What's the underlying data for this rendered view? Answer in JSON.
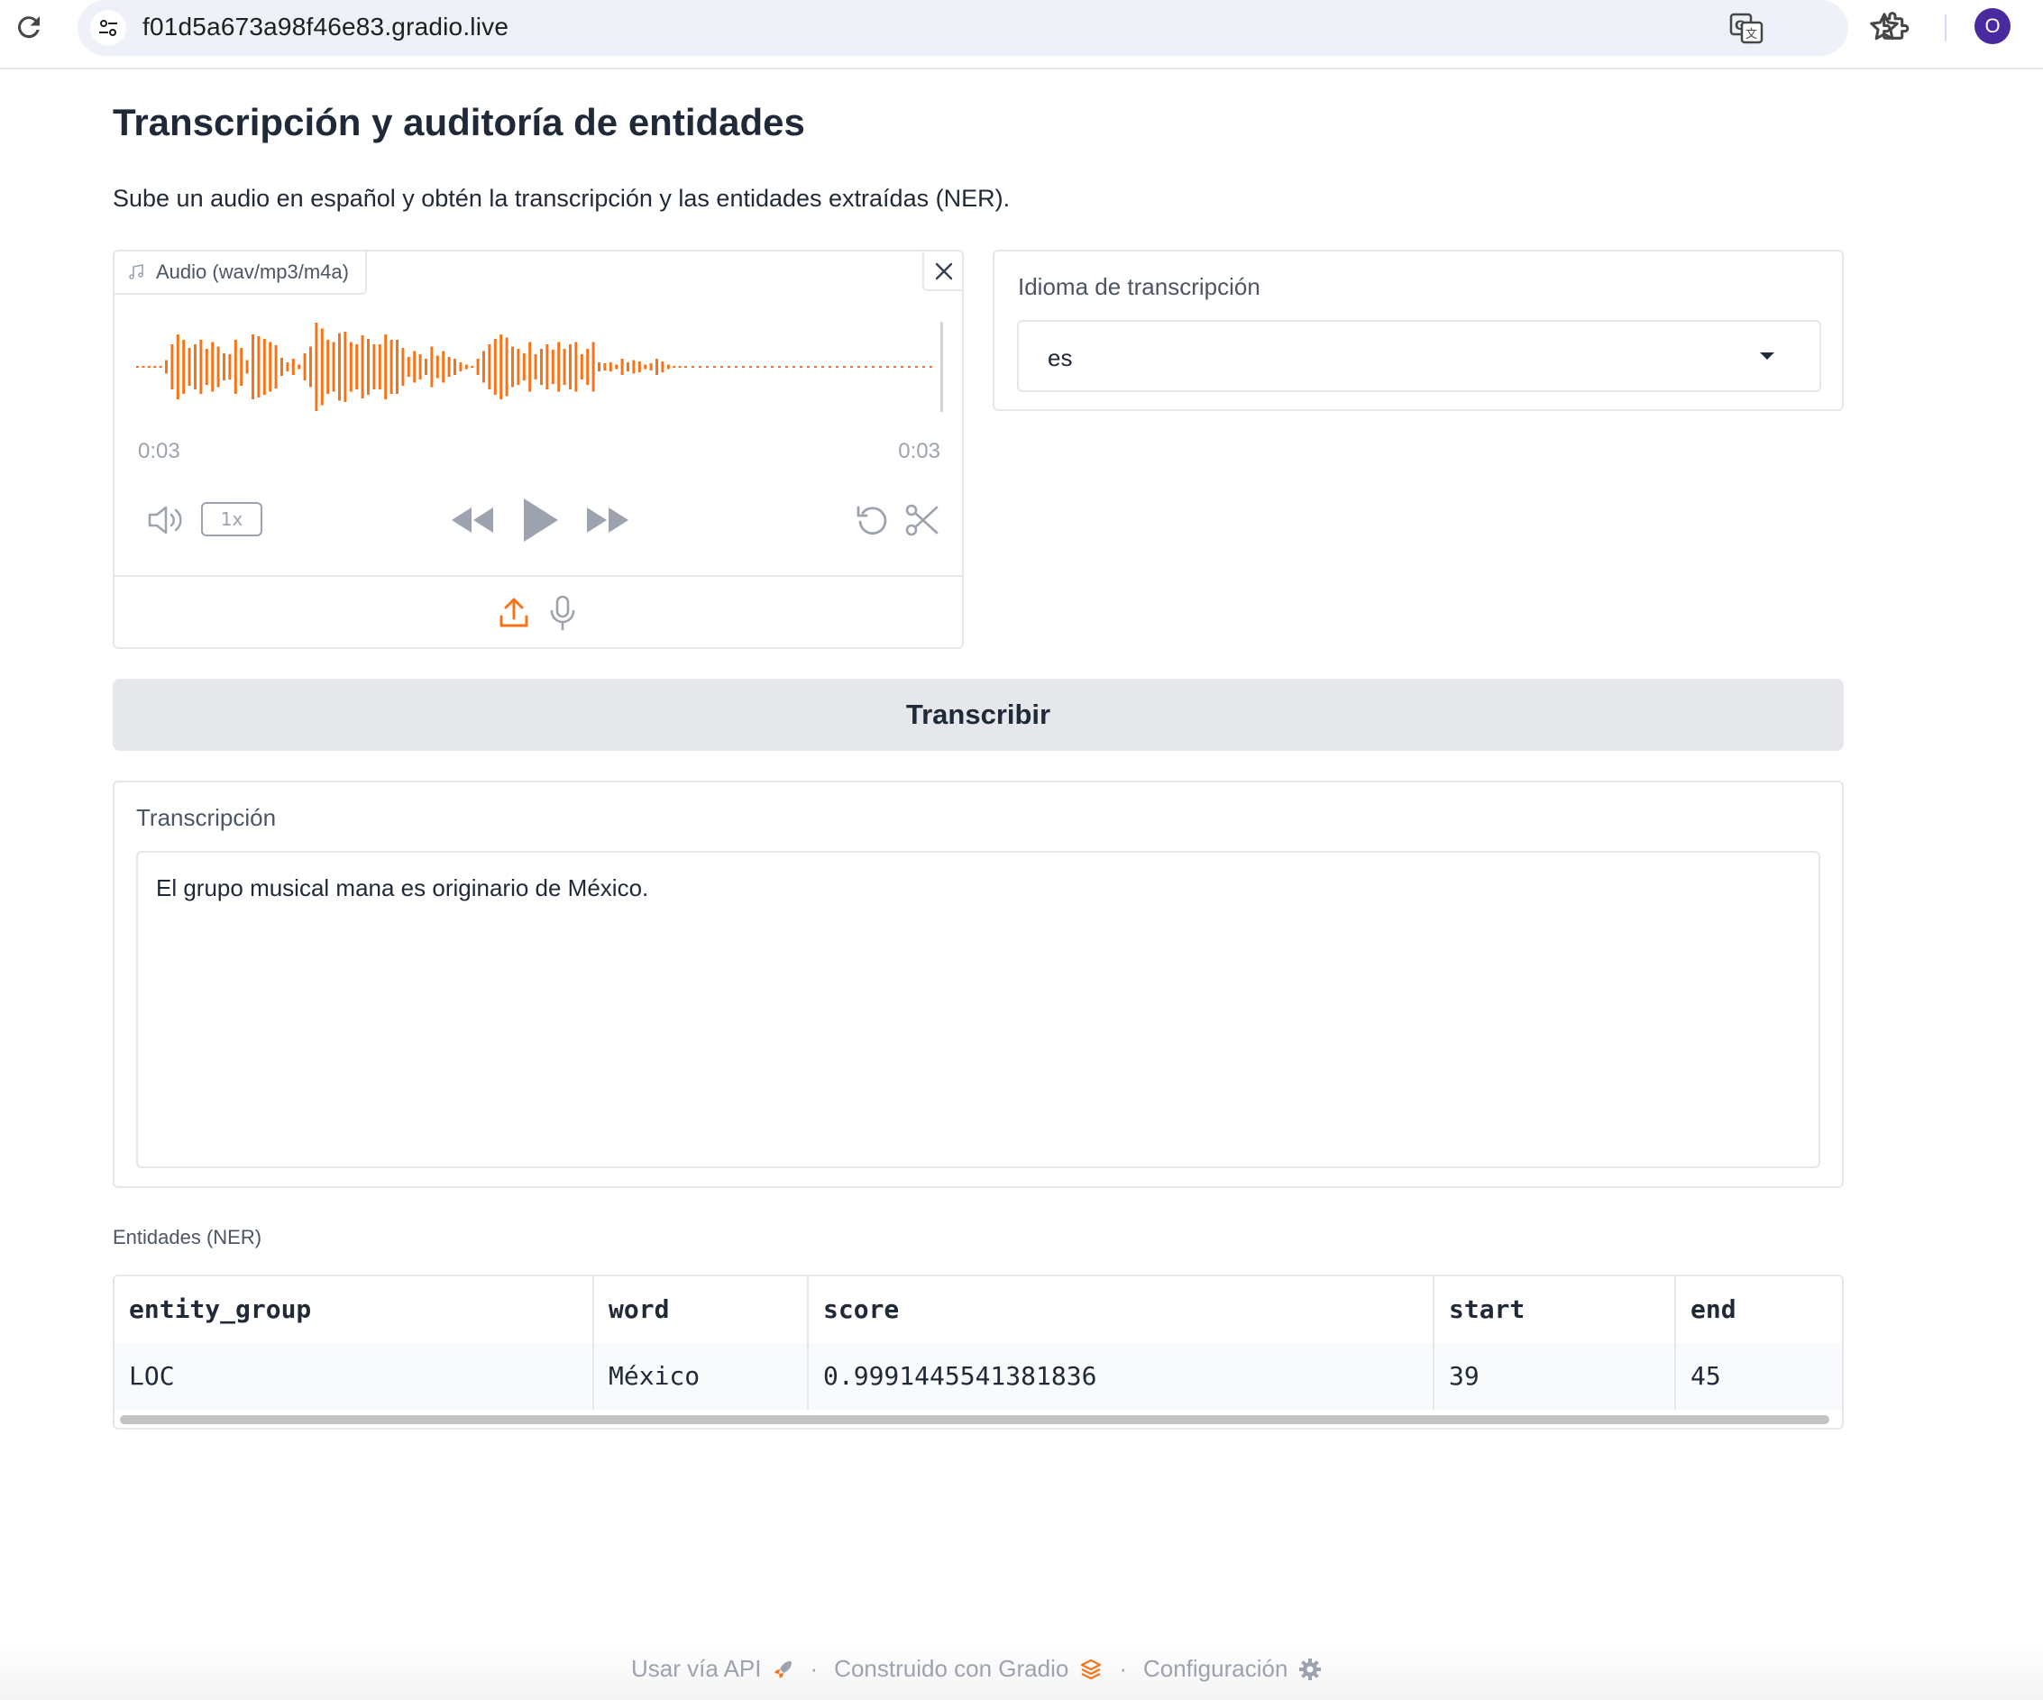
{
  "browser": {
    "url": "f01d5a673a98f46e83.gradio.live",
    "avatar_letter": "O"
  },
  "app": {
    "title": "Transcripción y auditoría de entidades",
    "description": "Sube un audio en español y obtén la transcripción y las entidades extraídas (NER).",
    "accent_color": "#f97316"
  },
  "audio": {
    "label": "Audio (wav/mp3/m4a)",
    "time_current": "0:03",
    "time_total": "0:03",
    "playback_rate": "1x"
  },
  "language": {
    "label": "Idioma de transcripción",
    "value": "es"
  },
  "transcribe_button": "Transcribir",
  "transcription": {
    "label": "Transcripción",
    "value": "El grupo musical mana es originario de México."
  },
  "ner": {
    "label": "Entidades (NER)",
    "columns": [
      "entity_group",
      "word",
      "score",
      "start",
      "end"
    ],
    "rows": [
      [
        "LOC",
        "México",
        "0.9991445541381836",
        "39",
        "45"
      ]
    ]
  },
  "footer": {
    "api": "Usar vía API",
    "built": "Construido con Gradio",
    "settings": "Configuración",
    "separator": "·"
  }
}
